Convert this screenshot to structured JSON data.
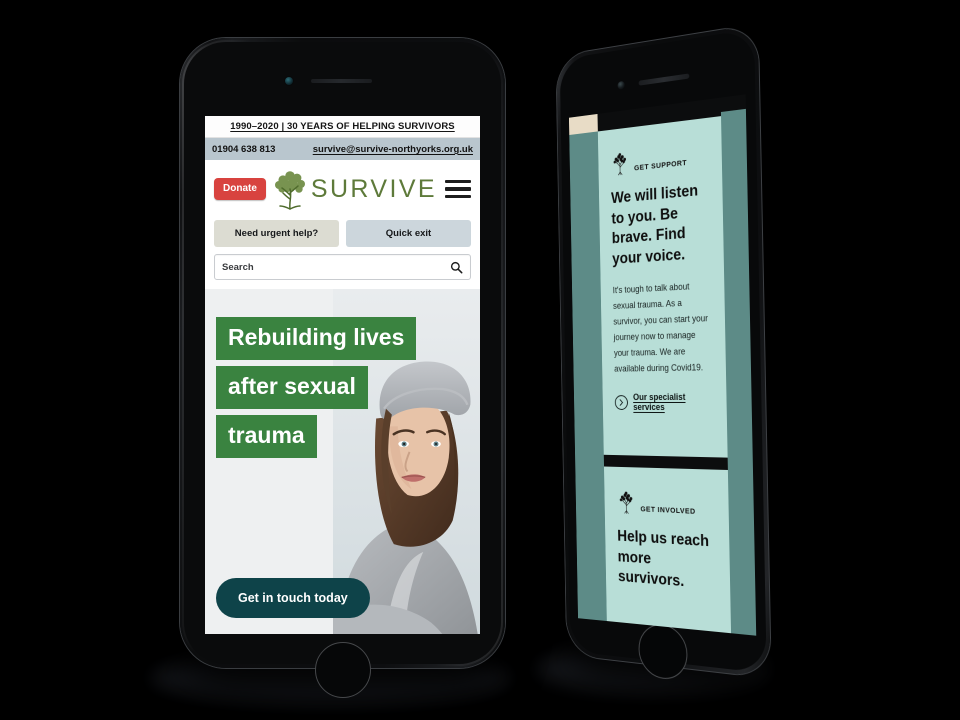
{
  "phone1": {
    "announcement": "1990–2020 | 30 YEARS OF HELPING SURVIVORS",
    "contact": {
      "phone": "01904 638 813",
      "email": "survive@survive-northyorks.org.uk"
    },
    "donate_label": "Donate",
    "logo_text": "SURVIVE",
    "menu_icon": "hamburger-menu-icon",
    "logo_icon": "tree-logo-icon",
    "utility_buttons": [
      {
        "label": "Need urgent help?",
        "style": "beige"
      },
      {
        "label": "Quick exit",
        "style": "blue-grey"
      }
    ],
    "search": {
      "placeholder": "Search",
      "icon": "search-icon"
    },
    "hero": {
      "lines": [
        "Rebuilding lives",
        "after sexual",
        "trauma"
      ],
      "cta_label": "Get in touch today",
      "image_alt": "young woman in grey hoodie and beanie"
    }
  },
  "phone2": {
    "sections": [
      {
        "eyebrow": "GET SUPPORT",
        "icon": "tree-logo-icon",
        "heading": "We will listen to you. Be brave. Find your voice.",
        "body": "It's tough to talk about sexual trauma. As a survivor, you can start your journey now to manage your trauma. We are available during Covid19.",
        "link_label": "Our specialist services",
        "link_icon": "chevron-right-circle-icon"
      },
      {
        "eyebrow": "GET INVOLVED",
        "icon": "tree-logo-icon",
        "heading": "Help us reach more survivors.",
        "body": "",
        "link_label": "",
        "link_icon": ""
      }
    ]
  },
  "colors": {
    "background": "#000000",
    "donate_red": "#d8433f",
    "hero_green": "#3a8340",
    "cta_teal": "#0e4349",
    "logo_green": "#5e7a3a",
    "contact_bar": "#b9c6ce",
    "card_mint": "#b8ded7",
    "card_edge_teal": "#5d8b87",
    "help_button": "#dcdcd2",
    "exit_button": "#ccd6dc"
  }
}
